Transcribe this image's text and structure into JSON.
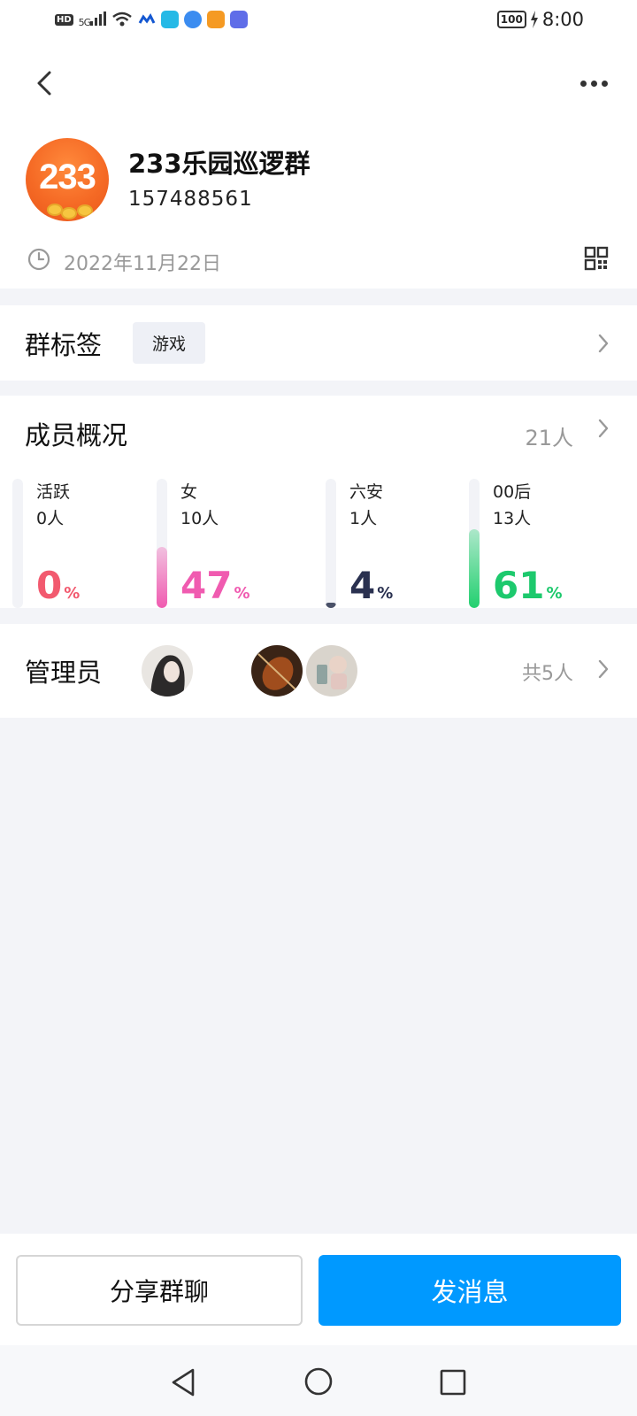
{
  "status_bar": {
    "hd": "HD",
    "network": "5G",
    "battery": "100",
    "time": "8:00"
  },
  "header": {
    "avatar_text": "233",
    "group_name": "233乐园巡逻群",
    "group_id": "157488561",
    "created_date": "2022年11月22日"
  },
  "tags_section": {
    "title": "群标签",
    "tags": [
      "游戏"
    ]
  },
  "members_section": {
    "title": "成员概况",
    "total": "21人",
    "stats": [
      {
        "label": "活跃",
        "count": "0人",
        "percent": "0",
        "percent_sign": "%",
        "fraction": 0.0,
        "color": "#f25a6f",
        "fill": "#f25a6f"
      },
      {
        "label": "女",
        "count": "10人",
        "percent": "47",
        "percent_sign": "%",
        "fraction": 0.47,
        "color": "#f05bb0",
        "fill": "#f05bb0"
      },
      {
        "label": "六安",
        "count": "1人",
        "percent": "4",
        "percent_sign": "%",
        "fraction": 0.04,
        "color": "#2a3150",
        "fill": "#4a5168"
      },
      {
        "label": "00后",
        "count": "13人",
        "percent": "61",
        "percent_sign": "%",
        "fraction": 0.61,
        "color": "#1dc96d",
        "fill": "#22d06f"
      }
    ]
  },
  "admins_section": {
    "title": "管理员",
    "total": "共5人"
  },
  "actions": {
    "share": "分享群聊",
    "send": "发消息"
  },
  "colors": {
    "accent": "#0099ff",
    "avatar_orange": "#f56a25"
  }
}
